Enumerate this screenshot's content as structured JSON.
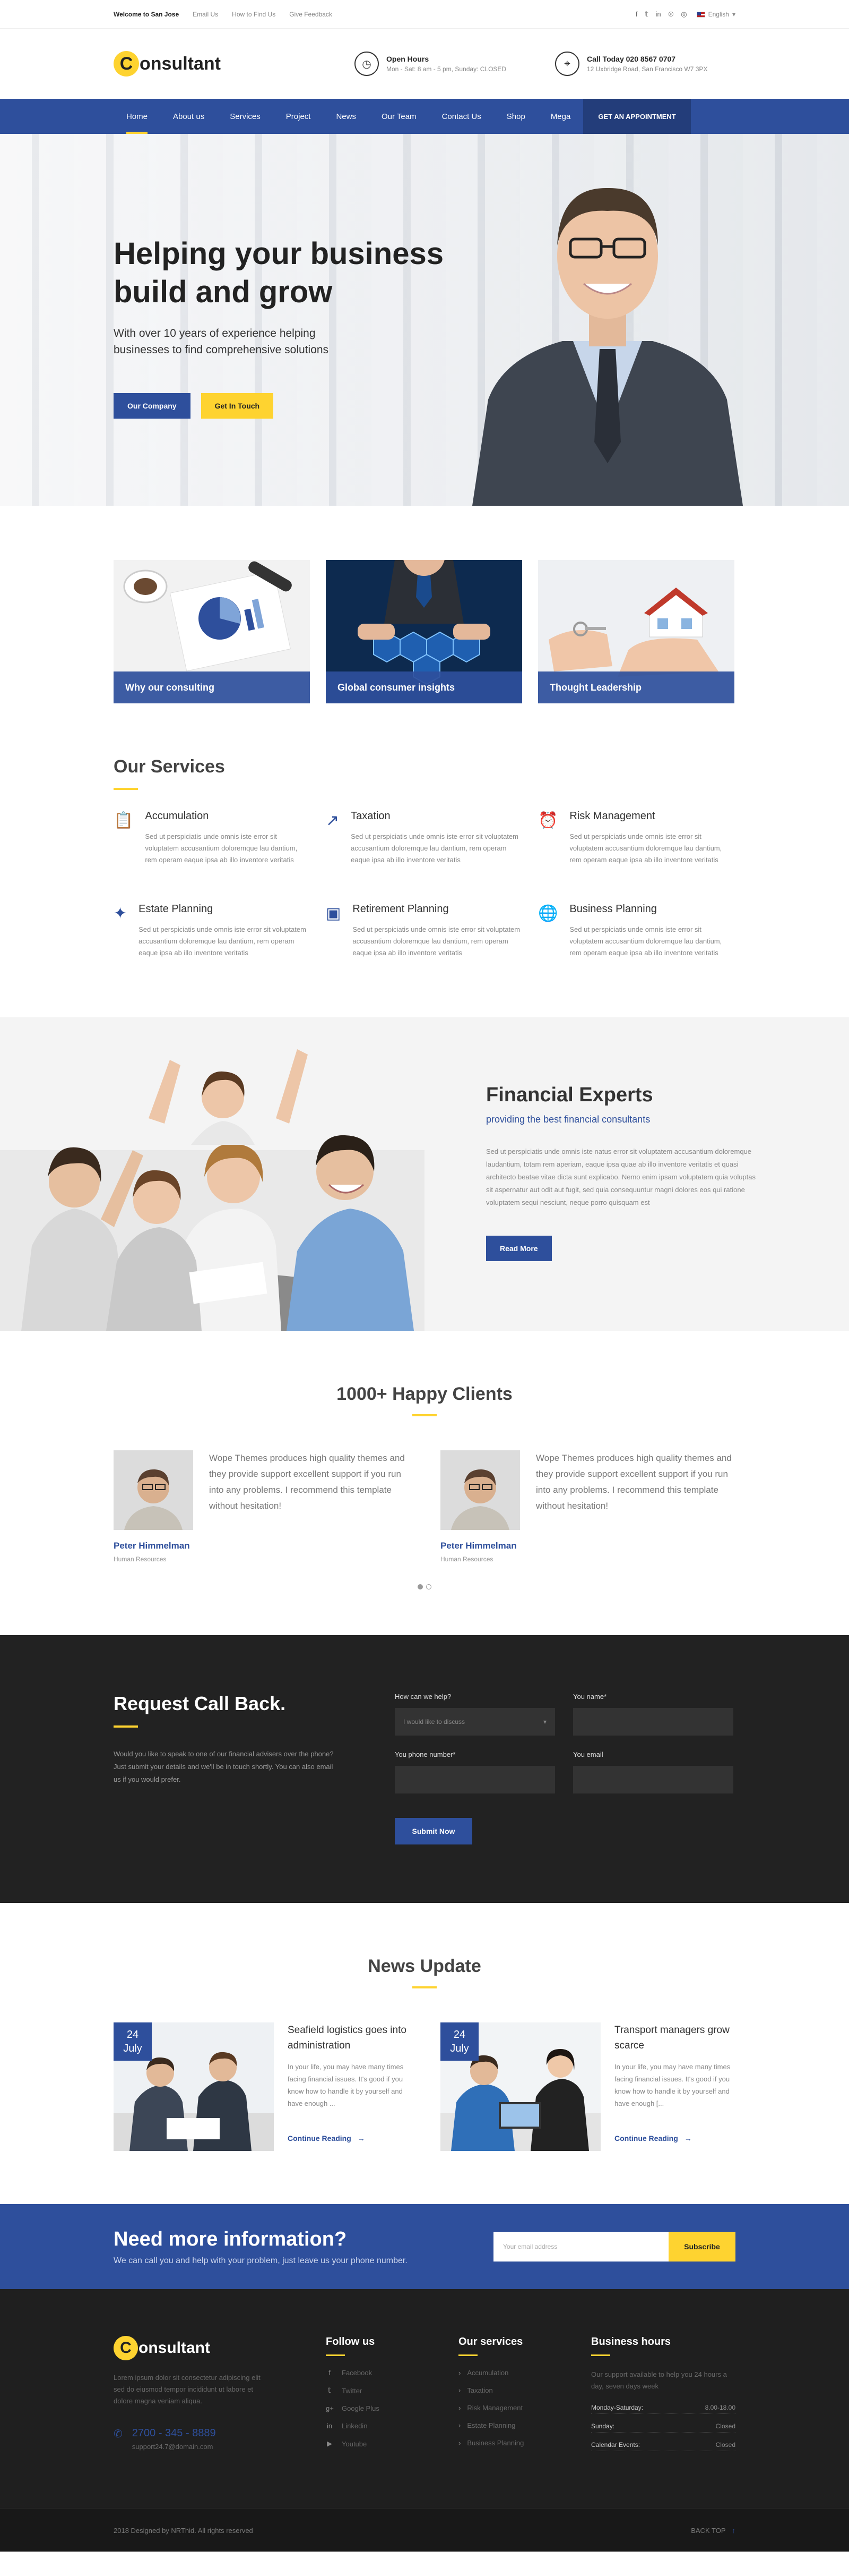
{
  "topbar": {
    "welcome": "Welcome to San Jose",
    "links": [
      "Email Us",
      "How to Find Us",
      "Give Feedback"
    ],
    "social_icons": [
      "facebook-icon",
      "twitter-icon",
      "linkedin-icon",
      "pinterest-icon",
      "instagram-icon"
    ],
    "language": "English"
  },
  "header": {
    "logo_initial": "C",
    "logo_rest": "onsultant",
    "hours_title": "Open Hours",
    "hours_text": "Mon - Sat: 8 am - 5 pm, Sunday: CLOSED",
    "call_title": "Call Today 020 8567 0707",
    "call_text": "12 Uxbridge Road, San Francisco W7 3PX"
  },
  "nav": {
    "items": [
      "Home",
      "About us",
      "Services",
      "Project",
      "News",
      "Our Team",
      "Contact Us",
      "Shop",
      "Mega"
    ],
    "active_index": 0,
    "cta": "GET AN APPOINTMENT"
  },
  "hero": {
    "title": "Helping your business build and grow",
    "subtitle": "With over 10 years of experience helping businesses to find comprehensive solutions",
    "btn_primary": "Our Company",
    "btn_secondary": "Get In Touch"
  },
  "features": [
    {
      "label": "Why our consulting"
    },
    {
      "label": "Global consumer insights"
    },
    {
      "label": "Thought Leadership"
    }
  ],
  "services": {
    "title": "Our Services",
    "items": [
      {
        "icon": "clipboard-icon",
        "title": "Accumulation",
        "text": "Sed ut perspiciatis unde omnis iste error sit voluptatem accusantium doloremque lau dantium, rem operam eaque ipsa ab illo inventore veritatis"
      },
      {
        "icon": "trending-up-icon",
        "title": "Taxation",
        "text": "Sed ut perspiciatis unde omnis iste error sit voluptatem accusantium doloremque lau dantium, rem operam eaque ipsa ab illo inventore veritatis"
      },
      {
        "icon": "alarm-clock-icon",
        "title": "Risk Management",
        "text": "Sed ut perspiciatis unde omnis iste error sit voluptatem accusantium doloremque lau dantium, rem operam eaque ipsa ab illo inventore veritatis"
      },
      {
        "icon": "magic-wand-icon",
        "title": "Estate Planning",
        "text": "Sed ut perspiciatis unde omnis iste error sit voluptatem accusantium doloremque lau dantium, rem operam eaque ipsa ab illo inventore veritatis"
      },
      {
        "icon": "presentation-board-icon",
        "title": "Retirement Planning",
        "text": "Sed ut perspiciatis unde omnis iste error sit voluptatem accusantium doloremque lau dantium, rem operam eaque ipsa ab illo inventore veritatis"
      },
      {
        "icon": "globe-icon",
        "title": "Business Planning",
        "text": "Sed ut perspiciatis unde omnis iste error sit voluptatem accusantium doloremque lau dantium, rem operam eaque ipsa ab illo inventore veritatis"
      }
    ]
  },
  "experts": {
    "title": "Financial Experts",
    "subtitle": "providing the best financial consultants",
    "text": "Sed ut perspiciatis unde omnis iste natus error sit voluptatem accusantium doloremque laudantium, totam rem aperiam, eaque ipsa quae ab illo inventore veritatis et quasi architecto beatae vitae dicta sunt explicabo. Nemo enim ipsam voluptatem quia voluptas sit aspernatur aut odit aut fugit, sed quia consequuntur magni dolores eos qui ratione voluptatem sequi nesciunt, neque porro quisquam est",
    "button": "Read More"
  },
  "clients": {
    "title": "1000+ Happy Clients",
    "items": [
      {
        "quote": "Wope Themes produces high quality themes and they provide support excellent support if you run into any problems. I recommend this template without hesitation!",
        "name": "Peter Himmelman",
        "role": "Human Resources"
      },
      {
        "quote": "Wope Themes produces high quality themes and they provide support excellent support if you run into any problems. I recommend this template without hesitation!",
        "name": "Peter Himmelman",
        "role": "Human Resources"
      }
    ]
  },
  "callback": {
    "title": "Request Call Back.",
    "text": "Would you like to speak to one of our financial advisers over the phone? Just submit your details and we'll be in touch shortly. You can also email us if you would prefer.",
    "help_label": "How can we help?",
    "help_value": "I would like to discuss",
    "name_label": "You name*",
    "phone_label": "You phone number*",
    "email_label": "You email",
    "submit": "Submit Now"
  },
  "news": {
    "title": "News Update",
    "items": [
      {
        "day": "24",
        "month": "July",
        "title": "Seafield logistics goes into administration",
        "excerpt": "In your life, you may have many times facing financial issues. It's good if you know how to handle it by yourself and have enough ...",
        "more": "Continue Reading"
      },
      {
        "day": "24",
        "month": "July",
        "title": "Transport managers grow scarce",
        "excerpt": "In your life, you may have many times facing financial issues. It's good if you know how to handle it by yourself and have enough [...",
        "more": "Continue Reading"
      }
    ]
  },
  "newsletter": {
    "title": "Need more information?",
    "subtitle": "We can call you and help with your problem, just leave us your phone number.",
    "placeholder": "Your email address",
    "button": "Subscribe"
  },
  "footer": {
    "about": "Lorem ipsum dolor sit consectetur adipiscing elit sed do eiusmod tempor incididunt ut labore et dolore magna veniam aliqua.",
    "phone": "2700 - 345 - 8889",
    "email": "support24.7@domain.com",
    "follow_title": "Follow us",
    "follow": [
      {
        "icon": "facebook-icon",
        "label": "Facebook"
      },
      {
        "icon": "twitter-icon",
        "label": "Twitter"
      },
      {
        "icon": "google-plus-icon",
        "label": "Google Plus"
      },
      {
        "icon": "linkedin-icon",
        "label": "Linkedin"
      },
      {
        "icon": "youtube-icon",
        "label": "Youtube"
      }
    ],
    "services_title": "Our services",
    "services": [
      "Accumulation",
      "Taxation",
      "Risk Management",
      "Estate Planning",
      "Business Planning"
    ],
    "hours_title": "Business hours",
    "hours_intro": "Our support available to help you 24 hours a day, seven days week",
    "hours": [
      {
        "day": "Monday-Saturday:",
        "value": "8.00-18.00"
      },
      {
        "day": "Sunday:",
        "value": "Closed"
      },
      {
        "day": "Calendar Events:",
        "value": "Closed"
      }
    ]
  },
  "copyright": {
    "text": "2018 Designed by NRThid. All rights reserved",
    "back_top": "BACK TOP"
  },
  "colors": {
    "primary": "#2e4f9c",
    "accent": "#fed330",
    "dark": "#222222"
  }
}
